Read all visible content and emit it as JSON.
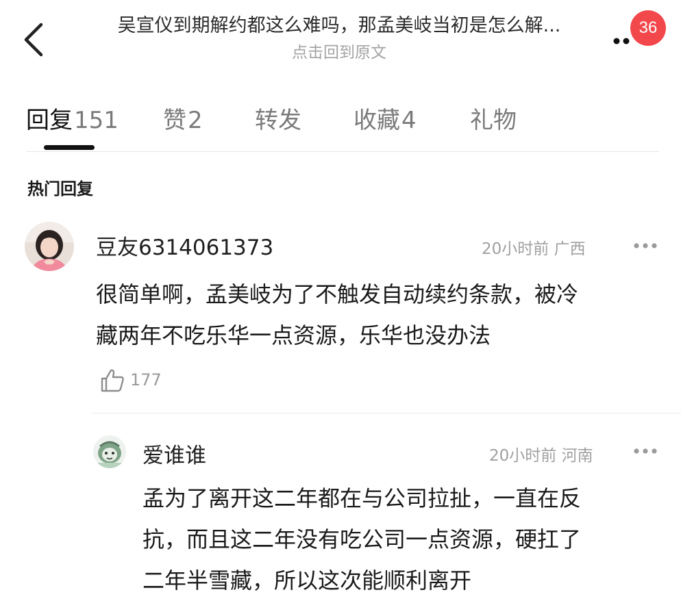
{
  "header": {
    "title": "吴宣仪到期解约都这么难吗，那孟美岐当初是怎么解...",
    "subtitle": "点击回到原文",
    "notification_count": "36",
    "badge_color": "#f2484c"
  },
  "tabs": [
    {
      "label": "回复",
      "count": "151",
      "active": true
    },
    {
      "label": "赞",
      "count": "2",
      "active": false
    },
    {
      "label": "转发",
      "count": "",
      "active": false
    },
    {
      "label": "收藏",
      "count": "4",
      "active": false
    },
    {
      "label": "礼物",
      "count": "",
      "active": false
    }
  ],
  "section_title": "热门回复",
  "comment": {
    "username": "豆友6314061373",
    "time": "20小时前",
    "location": "广西",
    "text_line1": "很简单啊，孟美岐为了不触发自动续约条款，被冷",
    "text_line2": "藏两年不吃乐华一点资源，乐华也没办法",
    "likes": "177",
    "avatar_icon": "avatar-girl-photo",
    "like_icon": "thumbs-up-icon"
  },
  "reply": {
    "username": "爱谁谁",
    "time": "20小时前",
    "location": "河南",
    "text_line1": "孟为了离开这二年都在与公司拉扯，一直在反",
    "text_line2": "抗，而且这二年没有吃公司一点资源，硬扛了",
    "text_line3": "二年半雪藏，所以这次能顺利离开",
    "avatar_icon": "avatar-cartoon"
  }
}
